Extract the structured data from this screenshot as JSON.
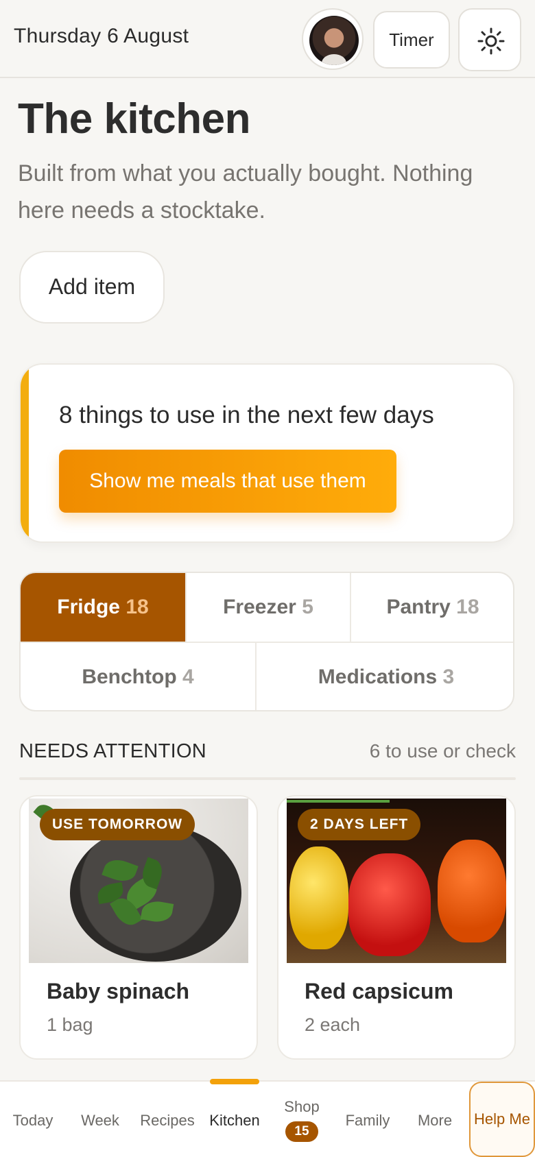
{
  "header": {
    "date": "Thursday 6 August",
    "timer_label": "Timer",
    "avatar_icon": "user-avatar",
    "theme_icon": "sun-icon"
  },
  "page": {
    "title": "The kitchen",
    "subtitle": "Built from what you actually bought. Nothing here needs a stocktake.",
    "add_item_label": "Add item"
  },
  "use_soon": {
    "heading": "8 things to use in the next few days",
    "button_label": "Show me meals that use them",
    "accent_color": "#f3ad0f"
  },
  "locations": [
    {
      "label": "Fridge",
      "count": "18",
      "active": true
    },
    {
      "label": "Freezer",
      "count": "5",
      "active": false
    },
    {
      "label": "Pantry",
      "count": "18",
      "active": false
    },
    {
      "label": "Benchtop",
      "count": "4",
      "active": false
    },
    {
      "label": "Medications",
      "count": "3",
      "active": false
    }
  ],
  "needs_attention": {
    "heading": "NEEDS ATTENTION",
    "meta": "6 to use or check",
    "items": [
      {
        "badge": "USE TOMORROW",
        "name": "Baby spinach",
        "qty": "1 bag"
      },
      {
        "badge": "2 DAYS LEFT",
        "name": "Red capsicum",
        "qty": "2 each"
      }
    ]
  },
  "nav": {
    "items": [
      {
        "label": "Today"
      },
      {
        "label": "Week"
      },
      {
        "label": "Recipes"
      },
      {
        "label": "Kitchen",
        "active": true
      },
      {
        "label": "Shop",
        "badge": "15"
      },
      {
        "label": "Family"
      },
      {
        "label": "More"
      }
    ],
    "help_label": "Help Me"
  },
  "colors": {
    "brand": "#a65500",
    "accent": "#f3a10a",
    "background": "#f7f6f3"
  }
}
